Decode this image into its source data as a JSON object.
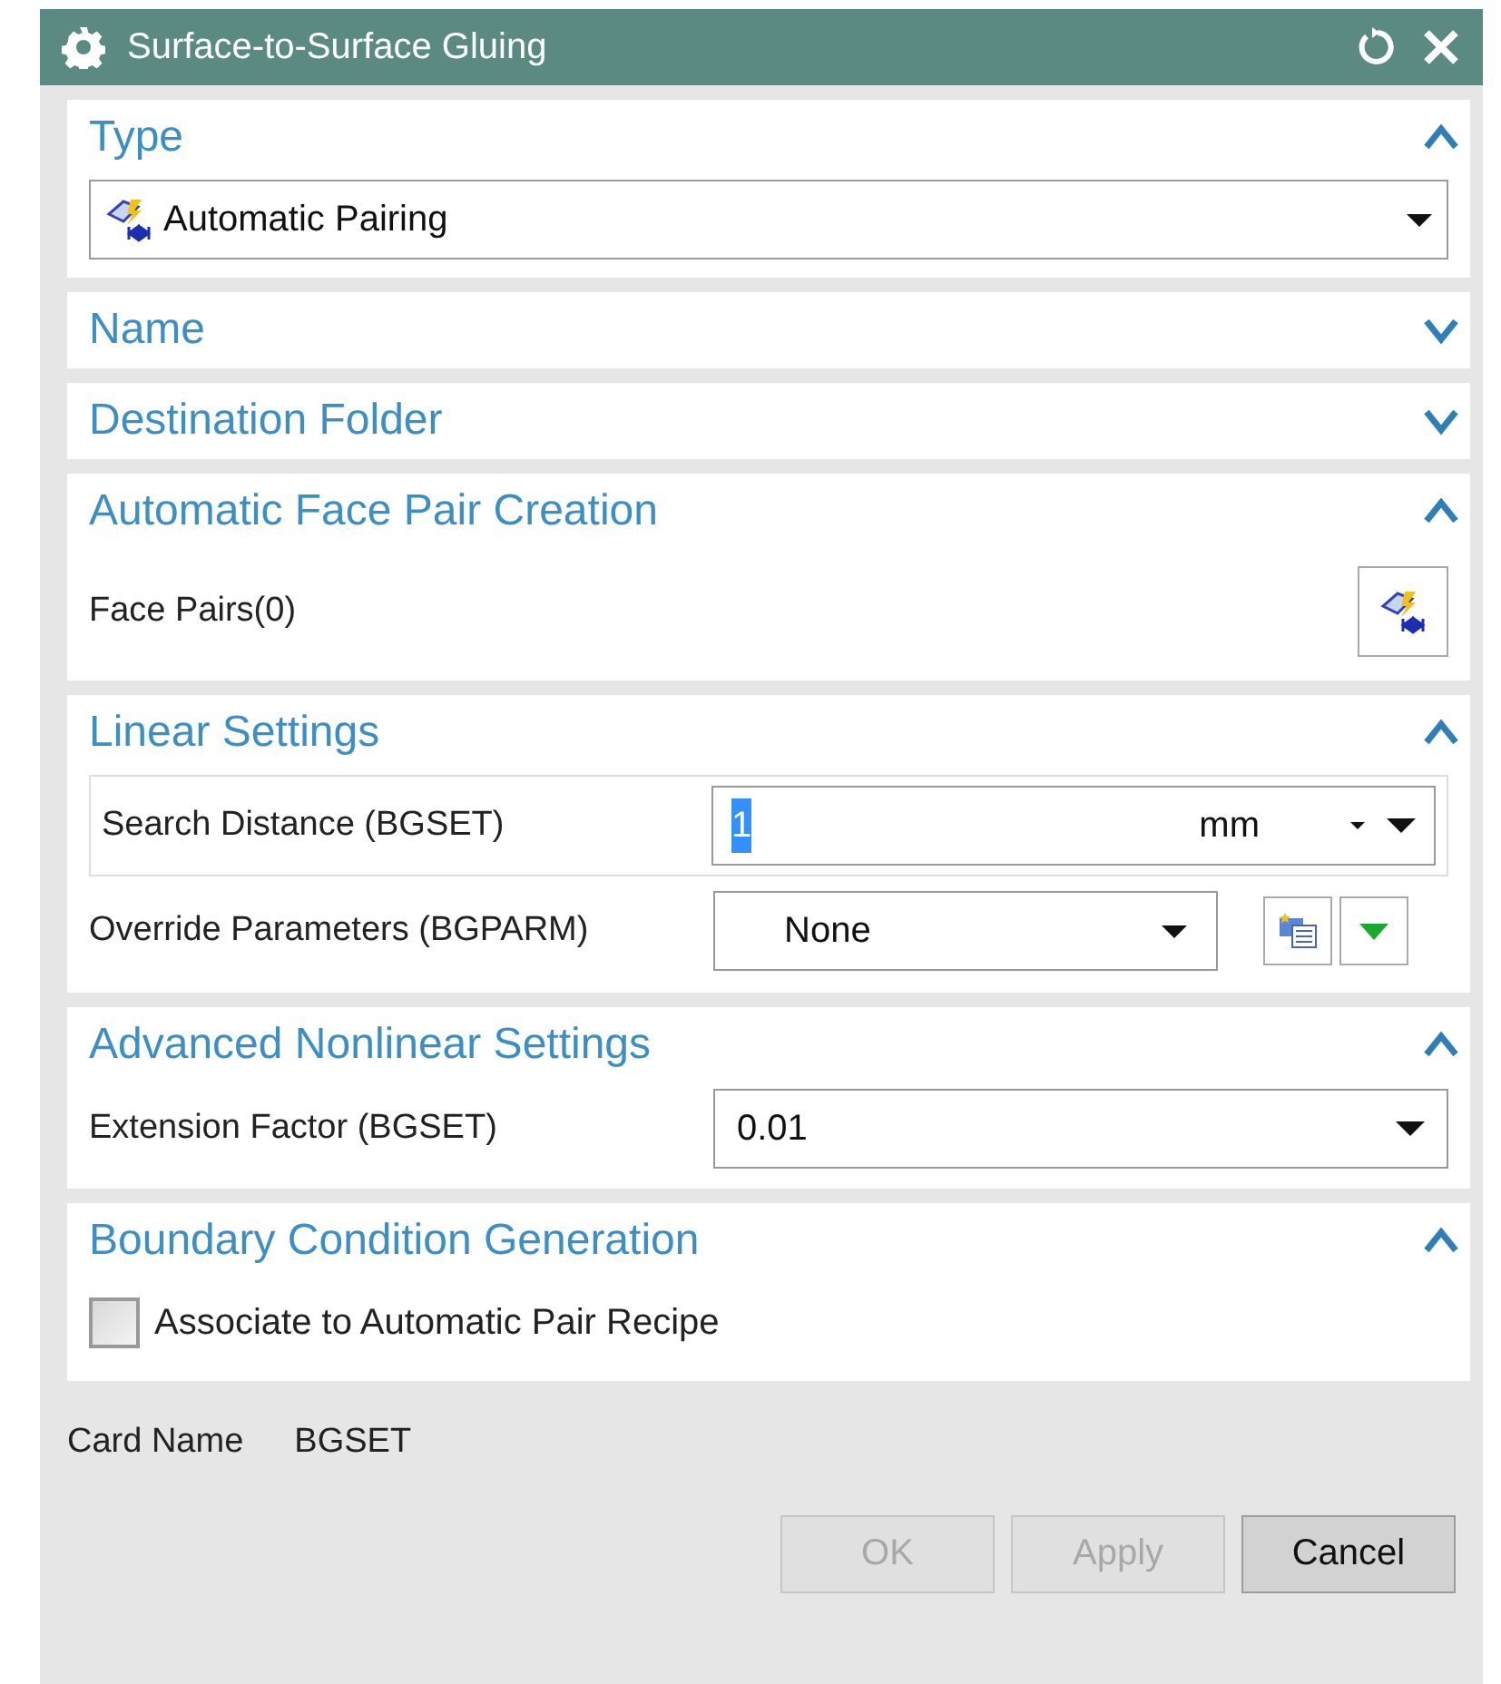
{
  "window": {
    "title": "Surface-to-Surface Gluing"
  },
  "sections": [
    {
      "title": "Type",
      "expanded": true,
      "rows": [
        {
          "kind": "icon_select",
          "value": "Automatic Pairing"
        }
      ]
    },
    {
      "title": "Name",
      "expanded": false
    },
    {
      "title": "Destination Folder",
      "expanded": false
    },
    {
      "title": "Automatic Face Pair Creation",
      "expanded": true,
      "rows": [
        {
          "kind": "button_row",
          "label": "Face Pairs(0)"
        }
      ]
    },
    {
      "title": "Linear Settings",
      "expanded": true,
      "rows": [
        {
          "kind": "unit_field",
          "label": "Search Distance (BGSET)",
          "value": "1",
          "unit": "mm",
          "value_selected": true
        },
        {
          "kind": "select_tools",
          "label": "Override Parameters (BGPARM)",
          "value": "None"
        }
      ]
    },
    {
      "title": "Advanced Nonlinear Settings",
      "expanded": true,
      "rows": [
        {
          "kind": "select",
          "label": "Extension Factor (BGSET)",
          "value": "0.01"
        }
      ]
    },
    {
      "title": "Boundary Condition Generation",
      "expanded": true,
      "rows": [
        {
          "kind": "checkbox",
          "label": "Associate to Automatic Pair Recipe",
          "checked": false
        }
      ]
    }
  ],
  "card_name": {
    "label": "Card Name",
    "value": "BGSET"
  },
  "buttons": [
    {
      "label": "OK",
      "disabled": true
    },
    {
      "label": "Apply",
      "disabled": true
    },
    {
      "label": "Cancel",
      "disabled": false
    }
  ]
}
